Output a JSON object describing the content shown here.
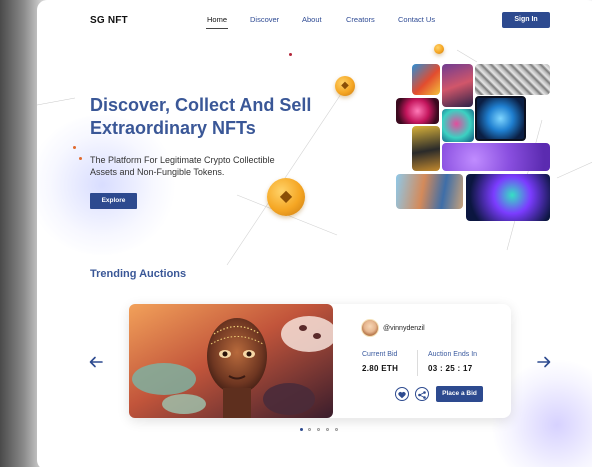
{
  "header": {
    "logo": "SG NFT",
    "nav": [
      {
        "label": "Home",
        "active": true
      },
      {
        "label": "Discover",
        "active": false
      },
      {
        "label": "About",
        "active": false
      },
      {
        "label": "Creators",
        "active": false
      },
      {
        "label": "Contact Us",
        "active": false
      }
    ],
    "signin_label": "Sign In"
  },
  "hero": {
    "title_line1": "Discover, Collect And Sell",
    "title_line2": "Extraordinary NFTs",
    "subtitle_line1": "The Platform For Legitimate Crypto Collectible",
    "subtitle_line2": "Assets and Non-Fungible Tokens.",
    "explore_label": "Explore"
  },
  "trending": {
    "title": "Trending Auctions",
    "auction": {
      "creator": "@vinnydenzil",
      "current_bid_label": "Current Bid",
      "current_bid": "2.80 ETH",
      "ends_label": "Auction Ends In",
      "ends_in": "03 : 25 : 17",
      "bid_label": "Place a Bid"
    },
    "pagination": {
      "total": 5,
      "active": 1
    }
  },
  "colors": {
    "brand": "#2d4a8f",
    "heading": "#3a5797",
    "coin": "#f5a623"
  },
  "icons": [
    "ethereum-coin-icon",
    "heart-icon",
    "share-icon",
    "arrow-left-icon",
    "arrow-right-icon"
  ]
}
